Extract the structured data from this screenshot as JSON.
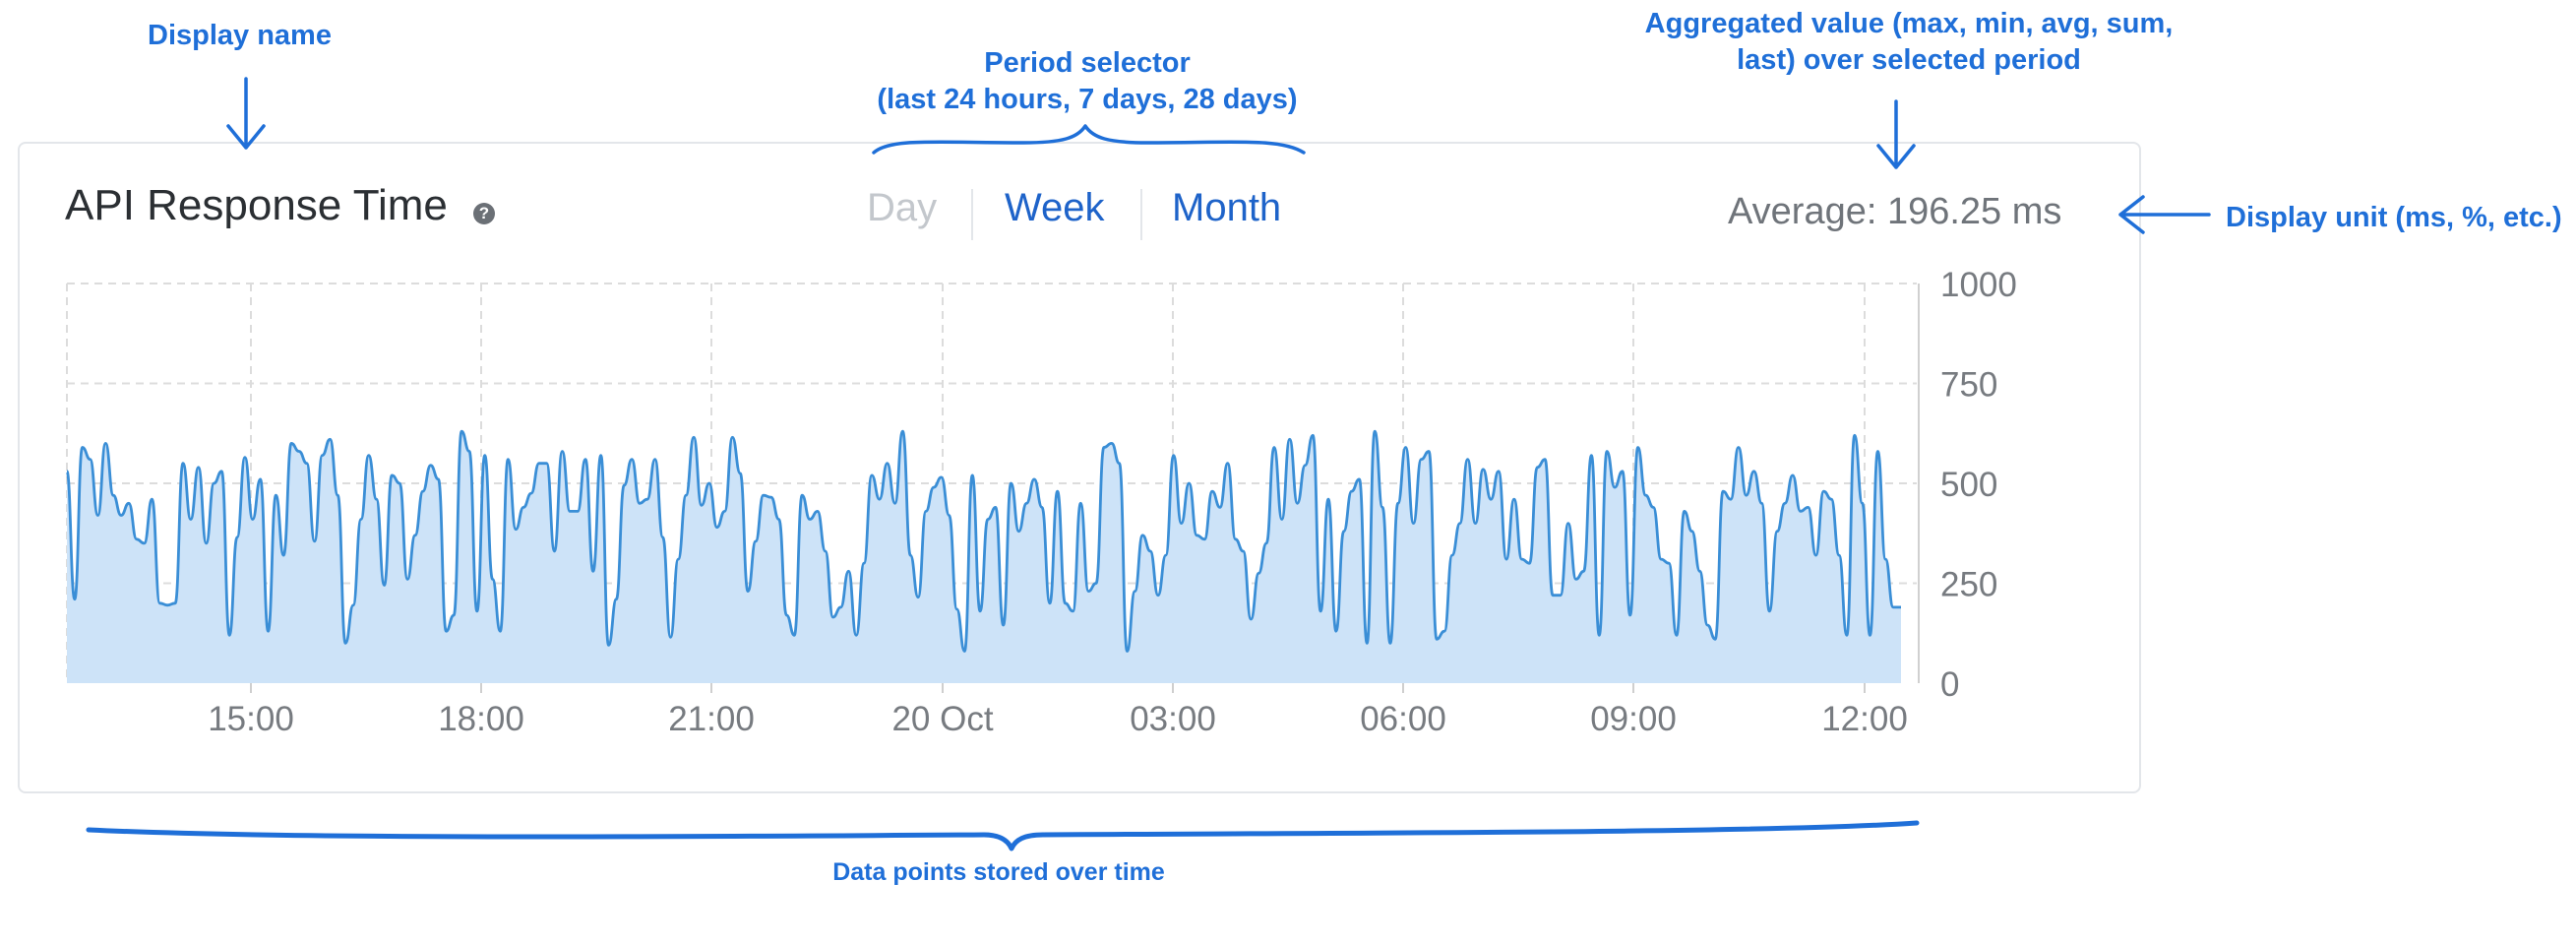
{
  "annotations": {
    "display_name": "Display name",
    "period_selector_line1": "Period selector",
    "period_selector_line2": "(last 24 hours, 7 days, 28 days)",
    "aggregated_line1": "Aggregated value (max, min, avg, sum,",
    "aggregated_line2": "last) over selected period",
    "display_unit": "Display unit (ms, %, etc.)",
    "data_points": "Data points stored over time"
  },
  "widget": {
    "title": "API Response Time",
    "help_glyph": "?",
    "periods": [
      "Day",
      "Week",
      "Month"
    ],
    "selected_period": "Day",
    "aggregate_text": "Average: 196.25 ms"
  },
  "colors": {
    "annotation": "#1f6fd8",
    "line": "#3a8ed6",
    "area": "#cde3f8",
    "grid": "#dddddd"
  },
  "chart_data": {
    "type": "area",
    "x_tick_labels": [
      "15:00",
      "18:00",
      "21:00",
      "20 Oct",
      "03:00",
      "06:00",
      "09:00",
      "12:00"
    ],
    "y_ticks": [
      0,
      250,
      500,
      750,
      1000
    ],
    "ylim": [
      0,
      1000
    ],
    "x_start": "12:36",
    "x_end": "12:48 (next day)",
    "grid": true,
    "values": [
      530,
      210,
      590,
      560,
      420,
      600,
      470,
      420,
      450,
      360,
      350,
      460,
      200,
      195,
      200,
      550,
      410,
      540,
      350,
      500,
      530,
      120,
      365,
      565,
      410,
      510,
      130,
      470,
      320,
      600,
      580,
      550,
      355,
      570,
      610,
      470,
      100,
      195,
      410,
      570,
      460,
      245,
      520,
      500,
      260,
      370,
      480,
      545,
      510,
      130,
      170,
      630,
      580,
      180,
      570,
      260,
      130,
      560,
      385,
      440,
      475,
      550,
      550,
      330,
      580,
      430,
      430,
      560,
      280,
      570,
      95,
      210,
      495,
      560,
      450,
      460,
      560,
      365,
      115,
      310,
      470,
      615,
      445,
      500,
      390,
      430,
      615,
      525,
      230,
      355,
      470,
      465,
      410,
      170,
      120,
      470,
      410,
      430,
      330,
      165,
      190,
      280,
      120,
      300,
      520,
      460,
      550,
      450,
      630,
      320,
      215,
      430,
      490,
      515,
      420,
      185,
      80,
      520,
      180,
      410,
      440,
      145,
      500,
      380,
      450,
      510,
      440,
      200,
      480,
      200,
      180,
      450,
      230,
      250,
      590,
      600,
      550,
      80,
      230,
      370,
      330,
      220,
      320,
      570,
      400,
      500,
      370,
      360,
      480,
      440,
      550,
      360,
      330,
      160,
      275,
      350,
      590,
      410,
      610,
      450,
      545,
      620,
      180,
      460,
      130,
      380,
      480,
      510,
      100,
      630,
      440,
      100,
      450,
      590,
      400,
      560,
      580,
      110,
      130,
      320,
      400,
      560,
      400,
      535,
      460,
      530,
      310,
      460,
      310,
      300,
      540,
      560,
      220,
      220,
      400,
      260,
      280,
      570,
      120,
      580,
      490,
      530,
      170,
      590,
      470,
      440,
      310,
      300,
      120,
      430,
      380,
      280,
      145,
      110,
      480,
      460,
      590,
      470,
      530,
      450,
      180,
      380,
      450,
      520,
      430,
      440,
      320,
      480,
      460,
      320,
      120,
      620,
      450,
      120,
      580,
      310,
      190,
      190
    ]
  }
}
